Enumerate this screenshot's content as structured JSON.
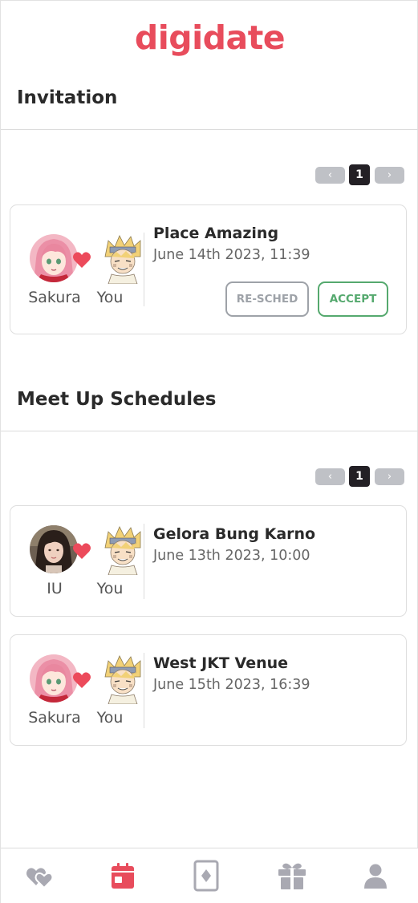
{
  "app": {
    "logo": "digidate",
    "brand_color": "#e84c5c"
  },
  "invitation": {
    "title": "Invitation",
    "pager": {
      "prev": "‹",
      "page": "1",
      "next": "›"
    },
    "items": [
      {
        "partner_name": "Sakura",
        "partner_avatar": "sakura-avatar",
        "you_label": "You",
        "place": "Place Amazing",
        "datetime": "June 14th 2023, 11:39",
        "resched_label": "RE-SCHED",
        "accept_label": "ACCEPT"
      }
    ]
  },
  "meetups": {
    "title": "Meet Up Schedules",
    "pager": {
      "prev": "‹",
      "page": "1",
      "next": "›"
    },
    "items": [
      {
        "partner_name": "IU",
        "partner_avatar": "iu-avatar",
        "you_label": "You",
        "place": "Gelora Bung Karno",
        "datetime": "June 13th 2023, 10:00"
      },
      {
        "partner_name": "Sakura",
        "partner_avatar": "sakura-avatar",
        "you_label": "You",
        "place": "West JKT Venue",
        "datetime": "June 15th 2023, 16:39"
      }
    ]
  },
  "bottom_nav": {
    "items": [
      {
        "icon": "hearts-icon",
        "active": false
      },
      {
        "icon": "calendar-icon",
        "active": true
      },
      {
        "icon": "card-icon",
        "active": false
      },
      {
        "icon": "gift-icon",
        "active": false
      },
      {
        "icon": "profile-icon",
        "active": false
      }
    ],
    "active_color": "#e84c5c",
    "inactive_color": "#a9a9b2"
  }
}
